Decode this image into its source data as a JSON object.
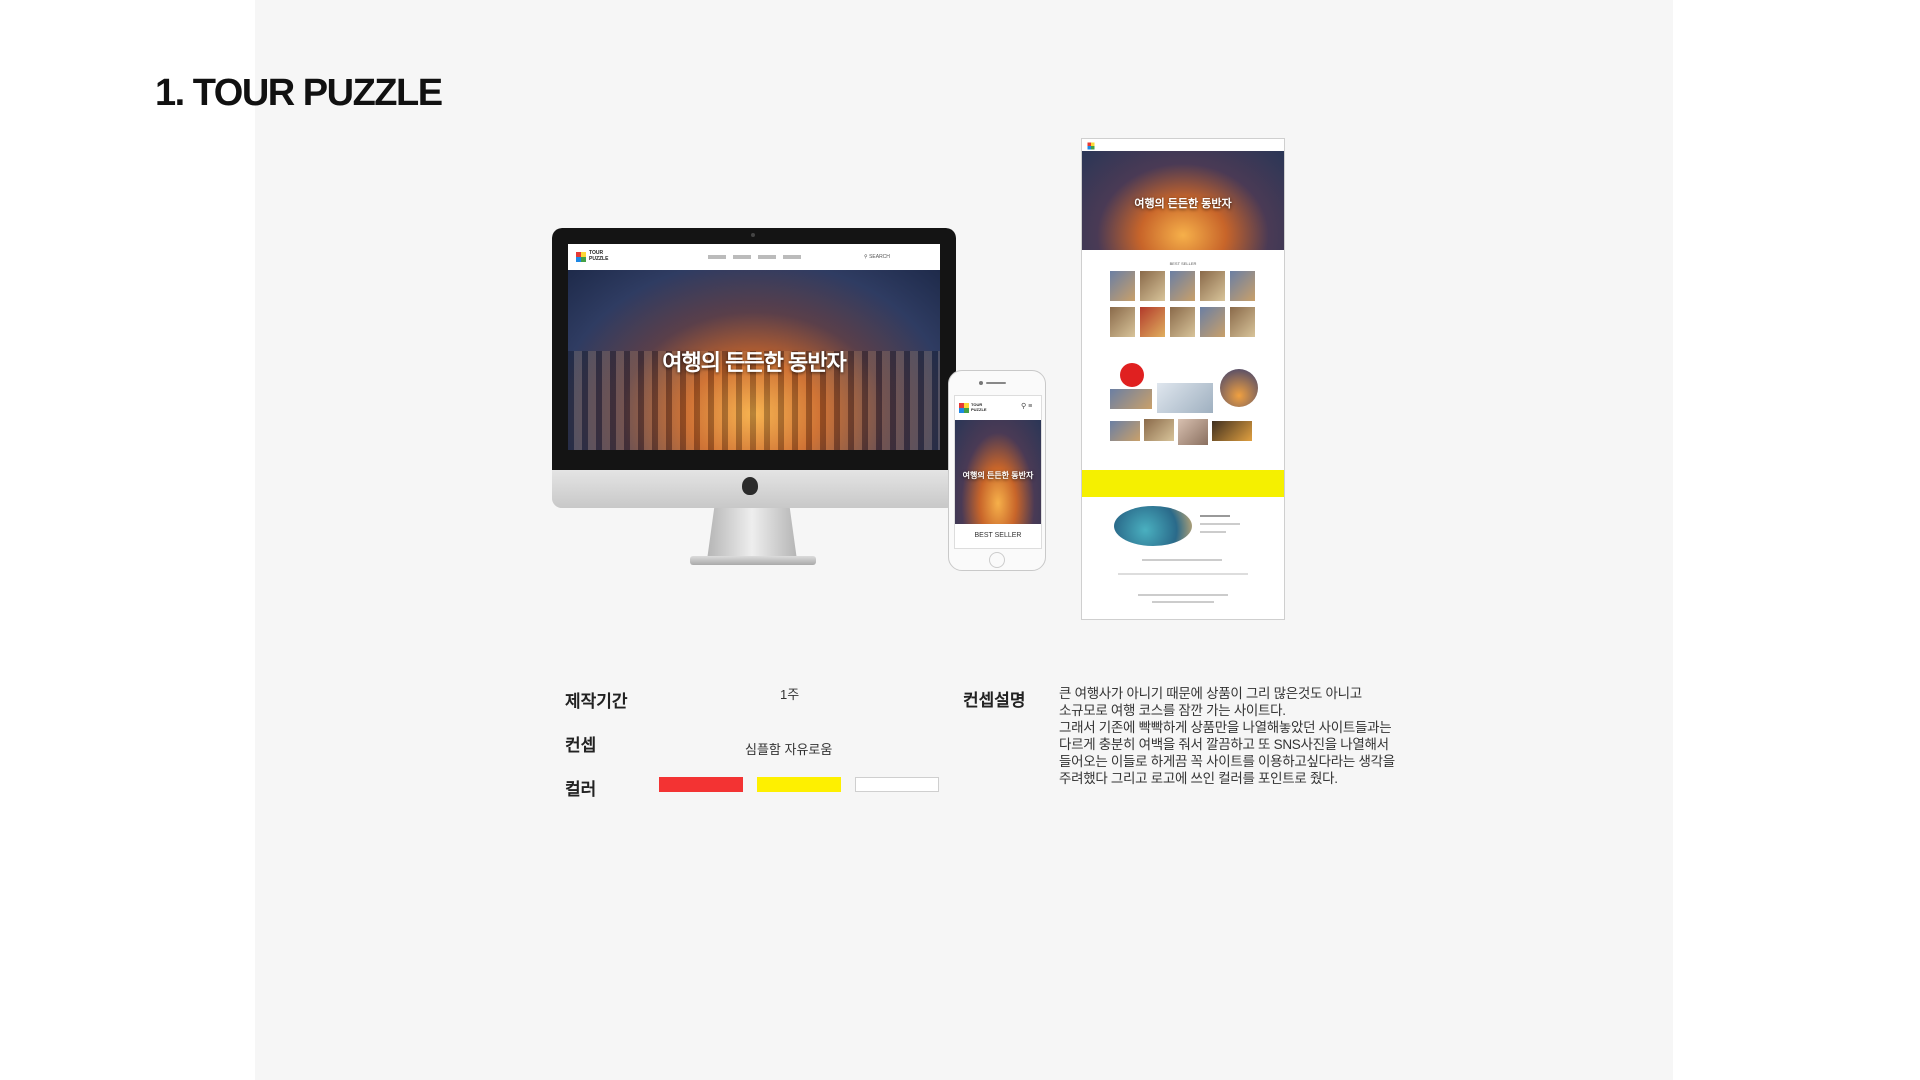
{
  "section_title": "1. TOUR PUZZLE",
  "mockup": {
    "logo_line1": "TOUR",
    "logo_line2": "PUZZLE",
    "hero_text": "여행의 든든한 동반자",
    "search_label": "SEARCH",
    "best_seller": "BEST SELLER"
  },
  "info": {
    "period_label": "제작기간",
    "period_value": "1주",
    "concept_label": "컨셉",
    "concept_value": "심플함 자유로움",
    "color_label": "컬러",
    "colors": [
      "#f33333",
      "#fef000",
      "#ffffff"
    ],
    "description_label": "컨셉설명",
    "description_lines": [
      "큰 여행사가 아니기 때문에 상품이 그리 많은것도 아니고",
      "소규모로 여행 코스를 잠깐 가는  사이트다.",
      "그래서 기존에 빡빡하게 상품만을 나열해놓았던 사이트들과는",
      "다르게 충분히 여백을 줘서 깔끔하고 또 SNS사진을 나열해서",
      "들어오는 이들로 하게끔 꼭 사이트를 이용하고싶다라는 생각을",
      "주려했다 그리고 로고에 쓰인 컬러를 포인트로 줬다."
    ]
  }
}
